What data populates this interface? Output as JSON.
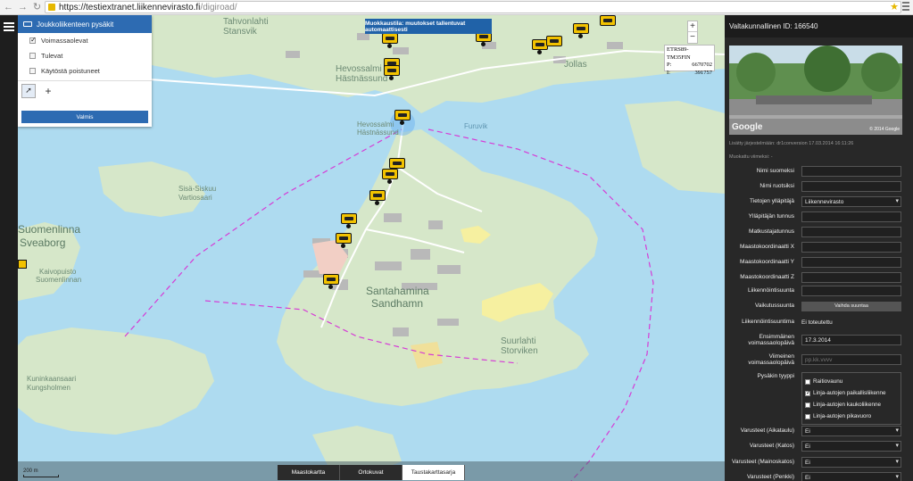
{
  "browser": {
    "url_host": "https://testiextranet.liikennevirasto.fi",
    "url_path": "/digiroad/"
  },
  "map": {
    "edit_banner": "Muokkaustila: muutokset tallentuvat automaattisesti",
    "coords": {
      "system": "ETRS89-TM35FIN",
      "p_label": "P:",
      "p_value": "6670702",
      "i_label": "I:",
      "i_value": "391757"
    },
    "zoom": {
      "in": "+",
      "out": "−"
    },
    "labels": [
      "Tahvonlahti",
      "Stansvik",
      "Jollas",
      "Hevossalmi",
      "Hästnässund",
      "Hevossalmi",
      "Hästnässund",
      "Suomenlinna",
      "Sveaborg",
      "Santahamina",
      "Sandhamn",
      "Suurlahti",
      "Storviken",
      "Kuninkaansaari",
      "Kungsholmen",
      "Furuvik",
      "Kaivopuisto",
      "Suomenlinnan",
      "Sisä-Siskuu",
      "Vartiosaari"
    ],
    "scale_label": "200 m",
    "basemap_tabs": [
      "Maastokartta",
      "Ortokuvat",
      "Taustakarttasarja"
    ],
    "active_basemap": "Taustakarttasarja"
  },
  "layer_panel": {
    "title": "Joukkoliikenteen pysäkit",
    "options": [
      {
        "label": "Voimassaolevat",
        "checked": true
      },
      {
        "label": "Tulevat",
        "checked": false
      },
      {
        "label": "Käytöstä poistuneet",
        "checked": false
      }
    ],
    "tool_select": "select-arrow",
    "tool_add": "+",
    "done_label": "Valmis"
  },
  "panel": {
    "title": "Valtakunnallinen ID: 166540",
    "streetview_brand": "Google",
    "streetview_copyright": "© 2014 Google",
    "added_by": "Lisätty järjestelmään: dr1conversion 17.03.2014 16:11:26",
    "modified": "Muokattu viimeksi: -",
    "fields": [
      {
        "label": "Nimi suomeksi",
        "value": ""
      },
      {
        "label": "Nimi ruotsiksi",
        "value": ""
      },
      {
        "label": "Tietojen ylläpitäjä",
        "value": "Liikennevirasto"
      },
      {
        "label": "Ylläpitäjän tunnus",
        "value": ""
      },
      {
        "label": "Matkustajatunnus",
        "value": ""
      },
      {
        "label": "Maastokoordinaatti X",
        "value": ""
      },
      {
        "label": "Maastokoordinaatti Y",
        "value": ""
      },
      {
        "label": "Maastokoordinaatti Z",
        "value": ""
      },
      {
        "label": "Liikennöintisuunta",
        "value": ""
      }
    ],
    "vaikutussuunta_label": "Vaikutussuunta",
    "vaihda_suuntaa": "Vaihda suuntaa",
    "liikennointisuuntima_label": "Liikennöintisuuntima",
    "liikennointisuuntima_value": "Ei toteutettu",
    "ensimmainen_label": "Ensimmäinen voimassaolopäivä",
    "ensimmainen_value": "17.3.2014",
    "viimeinen_label": "Viimeinen voimassaolopäivä",
    "viimeinen_placeholder": "pp.kk.vvvv",
    "pysakin_tyyppi_label": "Pysäkin tyyppi",
    "types": [
      {
        "label": "Raitiovaunu",
        "checked": false
      },
      {
        "label": "Linja-autojen paikallisliikenne",
        "checked": true
      },
      {
        "label": "Linja-autojen kaukoliikenne",
        "checked": false
      },
      {
        "label": "Linja-autojen pikavuoro",
        "checked": false
      }
    ],
    "varusteet": [
      {
        "label": "Varusteet (Aikataulu)",
        "value": "Ei"
      },
      {
        "label": "Varusteet (Katos)",
        "value": "Ei"
      },
      {
        "label": "Varusteet (Mainoskatos)",
        "value": "Ei"
      },
      {
        "label": "Varusteet (Penkki)",
        "value": "Ei"
      }
    ]
  }
}
